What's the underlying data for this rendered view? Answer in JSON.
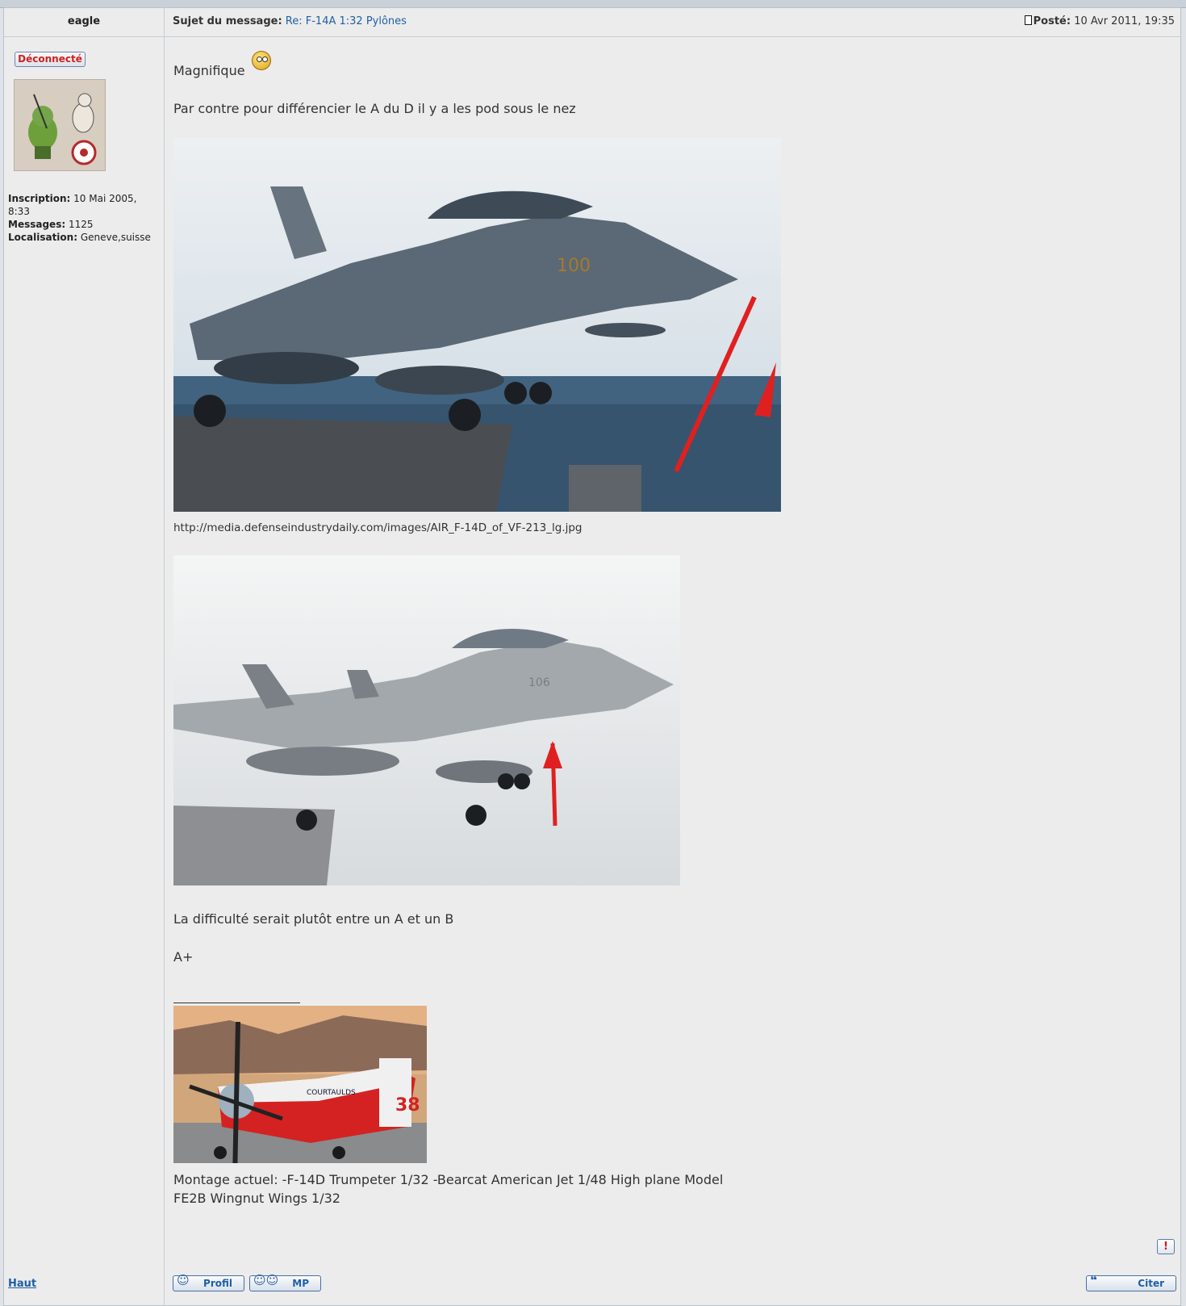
{
  "post": {
    "author": "eagle",
    "subject_label": "Sujet du message:",
    "subject": "Re: F-14A 1:32 Pylônes",
    "posted_label": "Posté:",
    "posted_date": "10 Avr 2011, 19:35"
  },
  "user": {
    "status": "Déconnecté",
    "inscription_label": "Inscription:",
    "inscription": "10 Mai 2005, 8:33",
    "messages_label": "Messages:",
    "messages": "1125",
    "localisation_label": "Localisation:",
    "localisation": "Geneve,suisse"
  },
  "body": {
    "line1": "Magnifique",
    "line2": "Par contre pour différencier le A du D il y a les pod sous le nez",
    "image1_url": "http://media.defenseindustrydaily.com/images/AIR_F-14D_of_VF-213_lg.jpg",
    "image1_number": "100",
    "image2_number": "106",
    "line3": "La difficulté serait plutôt entre un A et un B",
    "line4": "A+",
    "signature_plane_number": "38",
    "signature_plane_text": "COURTAULDS",
    "signature": "Montage actuel: -F-14D Trumpeter 1/32 -Bearcat American Jet 1/48 High plane Model FE2B Wingnut Wings 1/32"
  },
  "actions": {
    "top_link": "Haut",
    "profile": "Profil",
    "pm": "MP",
    "quote": "Citer",
    "report": "!"
  }
}
